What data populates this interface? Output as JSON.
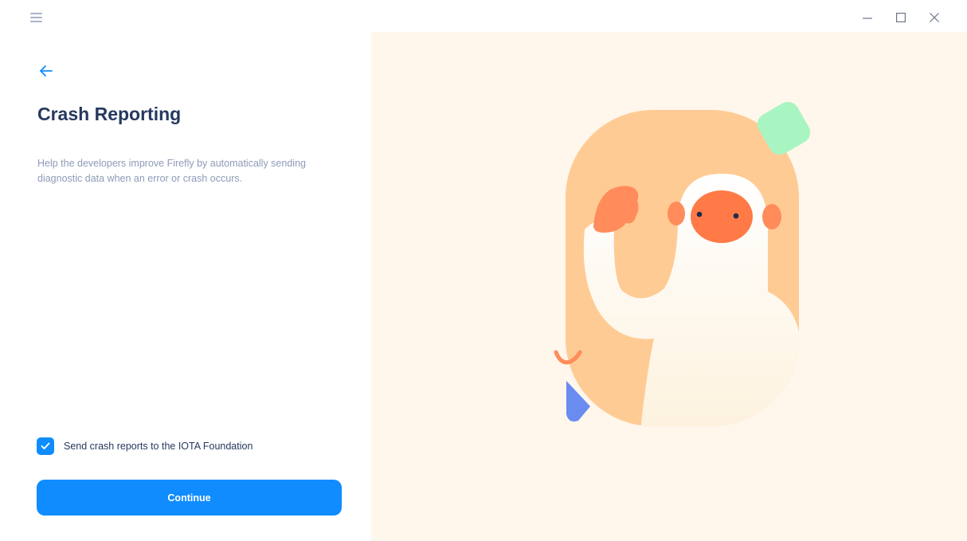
{
  "window": {
    "controls": {
      "minimize_icon": "minimize-icon",
      "maximize_icon": "maximize-icon",
      "close_icon": "close-icon"
    }
  },
  "navigation": {
    "menu_icon": "hamburger-menu-icon",
    "back_icon": "arrow-left-icon"
  },
  "content": {
    "title": "Crash Reporting",
    "description": "Help the developers improve Firefly by automatically sending diagnostic data when an error or crash occurs.",
    "checkbox": {
      "label": "Send crash reports to the IOTA Foundation",
      "checked": true
    },
    "continue_label": "Continue"
  },
  "colors": {
    "accent": "#108cff",
    "title": "#25395f",
    "description": "#8e9bb7",
    "illustration_background": "#fff6ec"
  }
}
